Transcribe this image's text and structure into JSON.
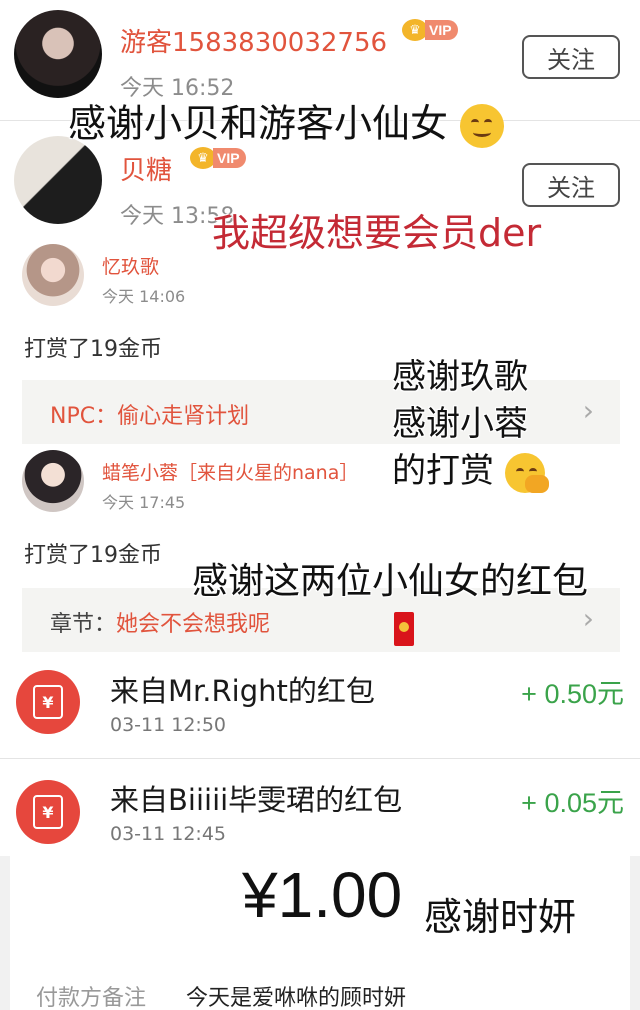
{
  "feed": {
    "follows": [
      {
        "username": "游客1583830032756",
        "vip": "VIP",
        "time": "今天 16:52",
        "follow_label": "关注"
      },
      {
        "username": "贝糖",
        "vip": "VIP",
        "time": "今天 13:58",
        "follow_label": "关注"
      }
    ],
    "tips": [
      {
        "username": "忆玖歌",
        "time": "今天 14:06",
        "action": "打赏了19金币",
        "ref_label": "NPC：",
        "ref_title": "偷心走肾计划"
      },
      {
        "username": "蜡笔小蓉［来自火星的nana］",
        "time": "今天 17:45",
        "action": "打赏了19金币",
        "ref_label": "章节：",
        "ref_title": "她会不会想我呢"
      }
    ]
  },
  "red_packets": [
    {
      "title": "来自Mr.Right的红包",
      "date": "03-11 12:50",
      "amount": "+ 0.50元",
      "icon": "yuan-envelope-icon",
      "icon_glyph": "¥"
    },
    {
      "title": "来自Biiiii毕雯珺的红包",
      "date": "03-11 12:45",
      "amount": "+ 0.05元",
      "icon": "yuan-envelope-icon",
      "icon_glyph": "¥"
    }
  ],
  "payment": {
    "amount": "¥1.00",
    "remark_label": "付款方备注",
    "remark": "今天是爱咻咻的顾时妍"
  },
  "captions": {
    "c1": "感谢小贝和游客小仙女",
    "c2": "我超级想要会员der",
    "c3_line1": "感谢玖歌",
    "c3_line2": "感谢小蓉",
    "c3_line3": "的打赏",
    "c4": "感谢这两位小仙女的红包",
    "c5": "感谢时妍"
  },
  "chevron_glyph": "›",
  "colors": {
    "accent_red": "#e1543d",
    "amount_green": "#3aa34a",
    "packet_red": "#e6473d",
    "caption_red": "#c42a35"
  }
}
